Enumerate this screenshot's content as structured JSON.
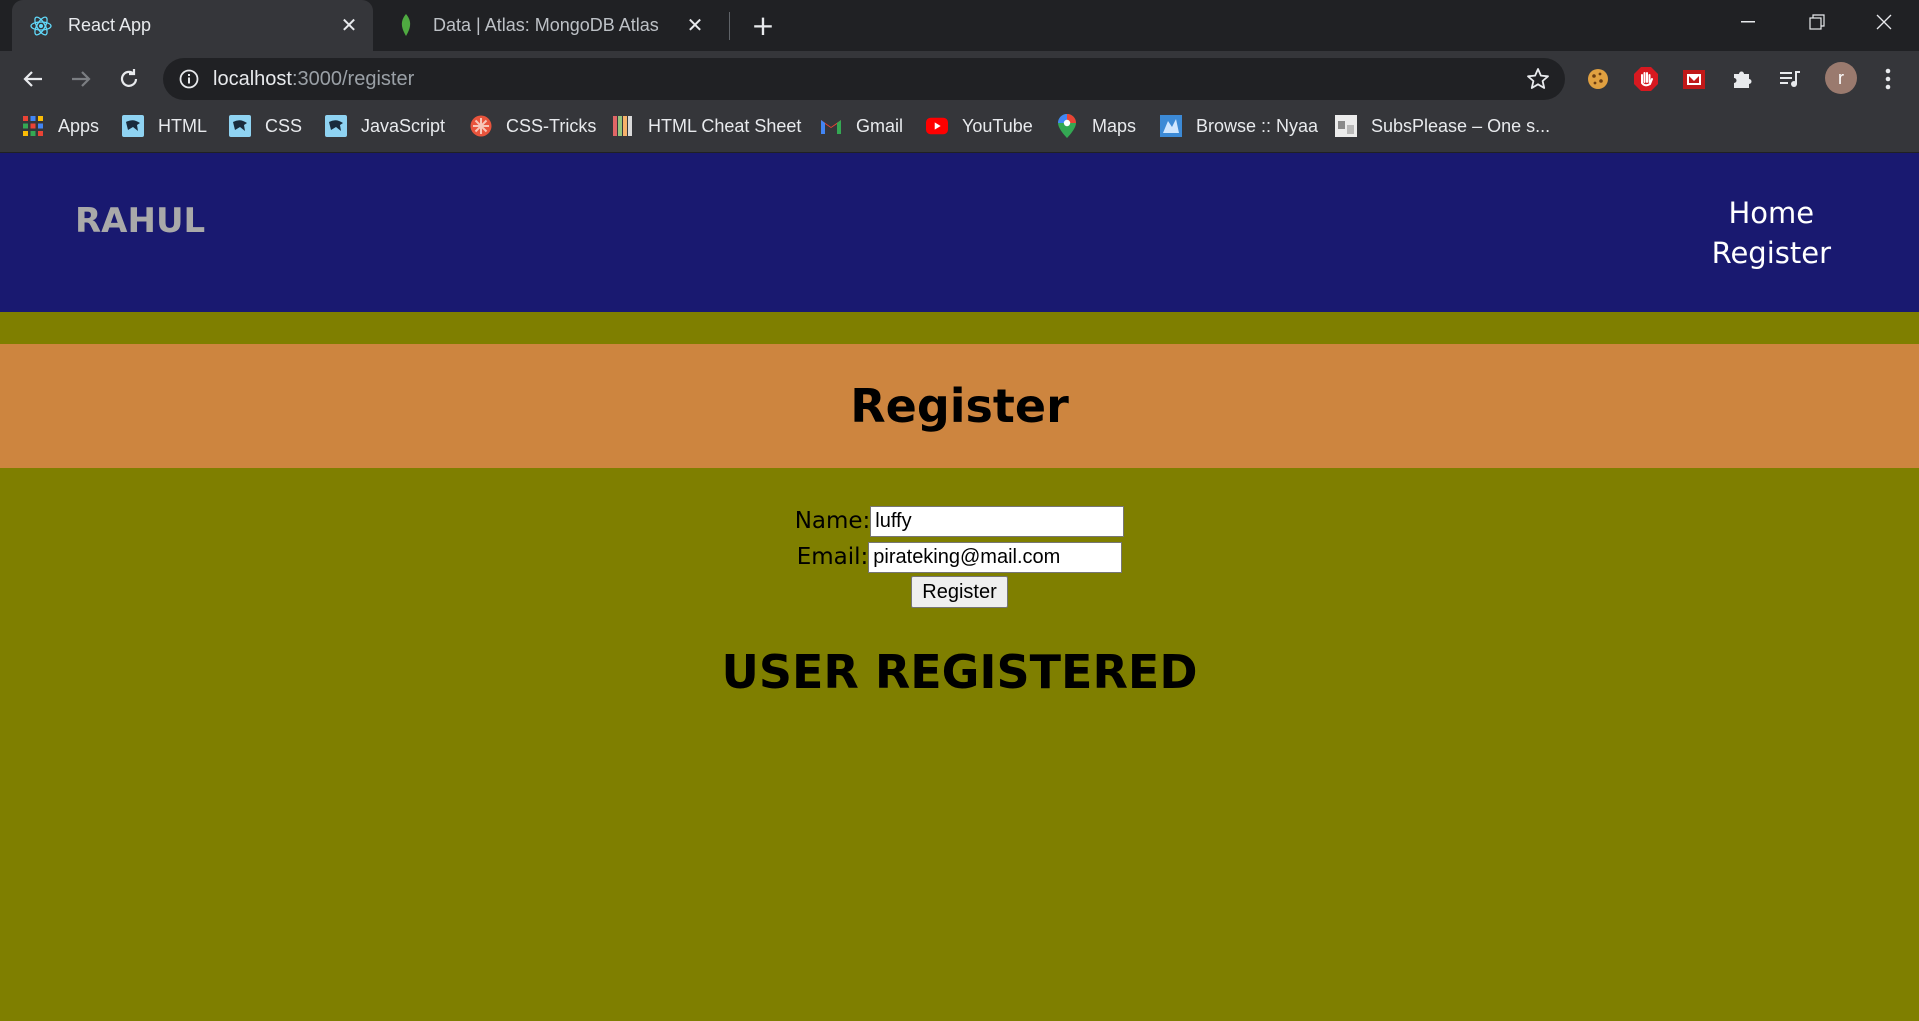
{
  "browser": {
    "tabs": [
      {
        "title": "React App",
        "icon": "react-icon",
        "active": true
      },
      {
        "title": "Data | Atlas: MongoDB Atlas",
        "icon": "mongodb-leaf-icon",
        "active": false
      }
    ],
    "address": {
      "host": "localhost",
      "path": ":3000/register"
    },
    "bookmarks": [
      {
        "label": "Apps",
        "icon": "apps-grid-icon"
      },
      {
        "label": "HTML",
        "icon": "panther-icon"
      },
      {
        "label": "CSS",
        "icon": "panther-icon"
      },
      {
        "label": "JavaScript",
        "icon": "panther-icon"
      },
      {
        "label": "CSS-Tricks",
        "icon": "css-tricks-icon"
      },
      {
        "label": "HTML Cheat Sheet",
        "icon": "cheatsheet-icon"
      },
      {
        "label": "Gmail",
        "icon": "gmail-icon"
      },
      {
        "label": "YouTube",
        "icon": "youtube-icon"
      },
      {
        "label": "Maps",
        "icon": "maps-pin-icon"
      },
      {
        "label": "Browse :: Nyaa",
        "icon": "nyaa-icon"
      },
      {
        "label": "SubsPlease – One s...",
        "icon": "subsplease-icon"
      }
    ],
    "profile_initial": "r"
  },
  "site": {
    "brand": "RAHUL",
    "nav": {
      "home": "Home",
      "register": "Register"
    },
    "heading": "Register",
    "form": {
      "name_label": "Name:",
      "name_value": "luffy",
      "email_label": "Email:",
      "email_value": "pirateking@mail.com",
      "submit_label": "Register"
    },
    "status_message": "USER REGISTERED"
  },
  "colors": {
    "navbar": "#191970",
    "page_bg": "#7f7f00",
    "header_band": "#cd853f",
    "brand_text": "#a9a9a9"
  }
}
